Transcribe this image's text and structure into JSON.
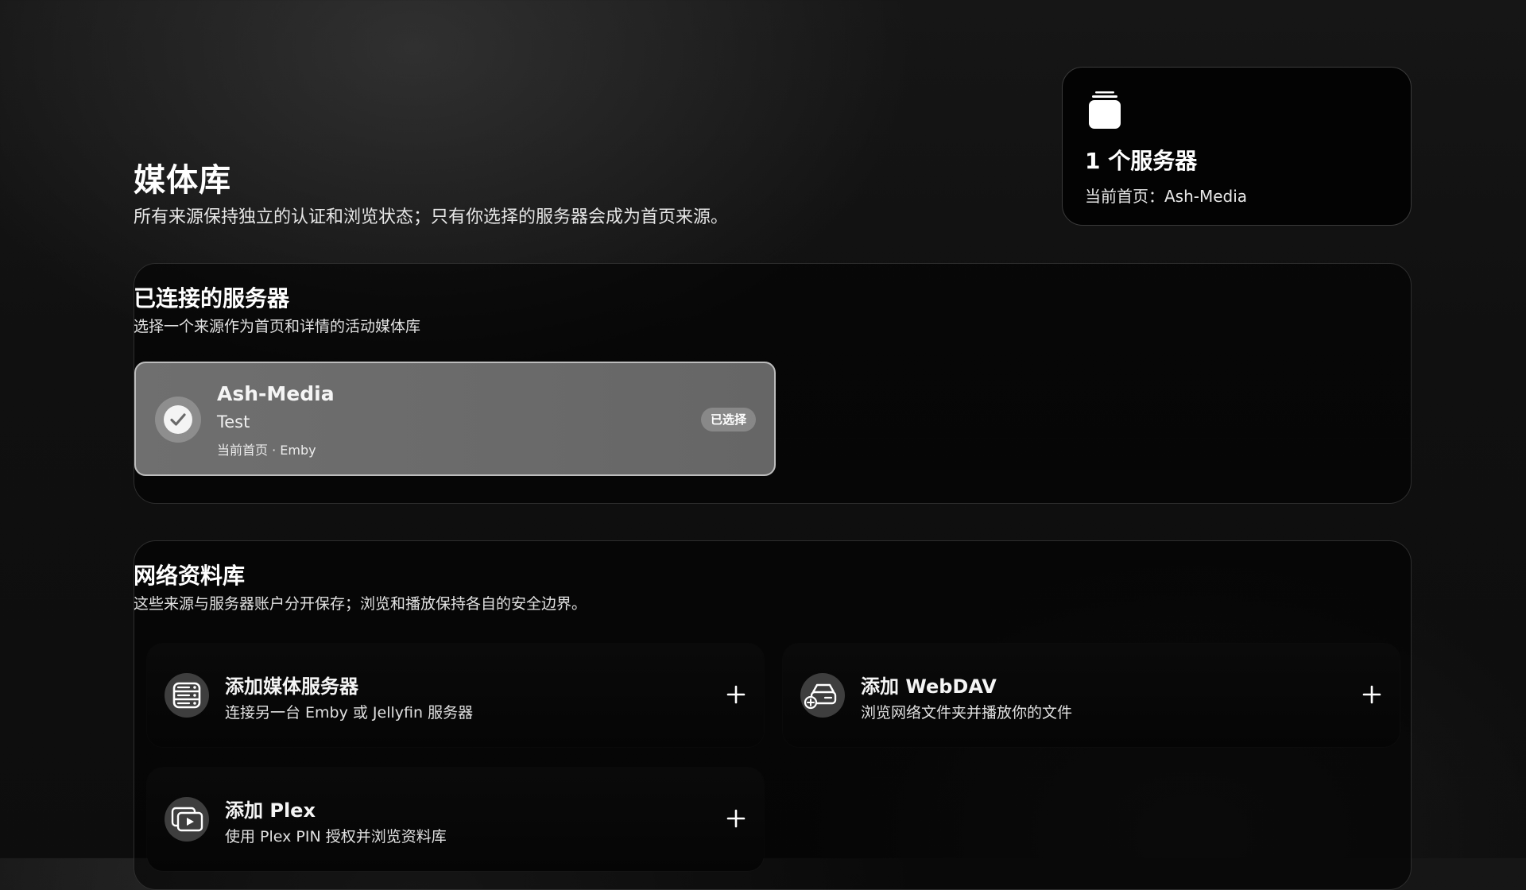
{
  "header": {
    "title": "媒体库",
    "subtitle": "所有来源保持独立的认证和浏览状态；只有你选择的服务器会成为首页来源。"
  },
  "summary": {
    "icon": "stack-icon",
    "count_label": "1 个服务器",
    "home_label": "当前首页：Ash-Media"
  },
  "connected": {
    "title": "已连接的服务器",
    "subtitle": "选择一个来源作为首页和详情的活动媒体库",
    "servers": [
      {
        "name": "Ash-Media",
        "user": "Test",
        "meta": "当前首页 · Emby",
        "badge": "已选择",
        "selected": true,
        "icon": "check-icon"
      }
    ]
  },
  "network": {
    "title": "网络资料库",
    "subtitle": "这些来源与服务器账户分开保存；浏览和播放保持各自的安全边界。",
    "sources": [
      {
        "title": "添加媒体服务器",
        "description": "连接另一台 Emby 或 Jellyfin 服务器",
        "icon": "server-icon",
        "action_icon": "plus-icon"
      },
      {
        "title": "添加 WebDAV",
        "description": "浏览网络文件夹并播放你的文件",
        "icon": "network-drive-icon",
        "action_icon": "plus-icon"
      },
      {
        "title": "添加 Plex",
        "description": "使用 Plex PIN 授权并浏览资料库",
        "icon": "plex-play-icon",
        "action_icon": "plus-icon"
      }
    ]
  },
  "colors": {
    "background": "#111111",
    "selected_card": "#6c6c6c",
    "selected_border": "#bdbdbd",
    "panel_border": "#2e2e2e",
    "icon_circle": "#3e3e3e",
    "text": "#ffffff"
  }
}
